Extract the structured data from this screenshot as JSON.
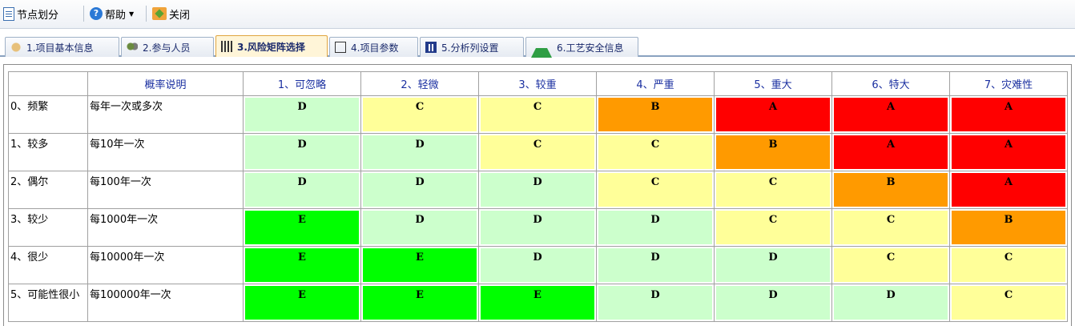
{
  "toolbar": {
    "items": [
      {
        "label": "节点划分",
        "icon": "document-icon"
      },
      {
        "label": "帮助",
        "icon": "help-icon"
      },
      {
        "label": "关闭",
        "icon": "close-icon"
      }
    ]
  },
  "tabs": [
    {
      "label": "1.项目基本信息",
      "icon": "hand-icon",
      "active": false
    },
    {
      "label": "2.参与人员",
      "icon": "people-icon",
      "active": false
    },
    {
      "label": "3.风险矩阵选择",
      "icon": "grid-icon",
      "active": true
    },
    {
      "label": "4.项目参数",
      "icon": "box-icon",
      "active": false
    },
    {
      "label": "5.分析列设置",
      "icon": "chart-icon",
      "active": false
    },
    {
      "label": "6.工艺安全信息",
      "icon": "flask-icon",
      "active": false
    }
  ],
  "matrix": {
    "corner": "",
    "desc_header": "概率说明",
    "columns": [
      "1、可忽略",
      "2、轻微",
      "3、较重",
      "4、严重",
      "5、重大",
      "6、特大",
      "7、灾难性"
    ],
    "colors": {
      "A": "#ff0000",
      "B": "#ff9a00",
      "C": "#ffff99",
      "D": "#ccffcc",
      "E": "#00ff00"
    },
    "rows": [
      {
        "label": "0、频繁",
        "desc": "每年一次或多次",
        "levels": [
          "D",
          "C",
          "C",
          "B",
          "A",
          "A",
          "A"
        ]
      },
      {
        "label": "1、较多",
        "desc": "每10年一次",
        "levels": [
          "D",
          "D",
          "C",
          "C",
          "B",
          "A",
          "A"
        ]
      },
      {
        "label": "2、偶尔",
        "desc": "每100年一次",
        "levels": [
          "D",
          "D",
          "D",
          "C",
          "C",
          "B",
          "A"
        ]
      },
      {
        "label": "3、较少",
        "desc": "每1000年一次",
        "levels": [
          "E",
          "D",
          "D",
          "D",
          "C",
          "C",
          "B"
        ]
      },
      {
        "label": "4、很少",
        "desc": "每10000年一次",
        "levels": [
          "E",
          "E",
          "D",
          "D",
          "D",
          "C",
          "C"
        ]
      },
      {
        "label": "5、可能性很小",
        "desc": "每100000年一次",
        "levels": [
          "E",
          "E",
          "E",
          "D",
          "D",
          "D",
          "C"
        ]
      }
    ]
  }
}
